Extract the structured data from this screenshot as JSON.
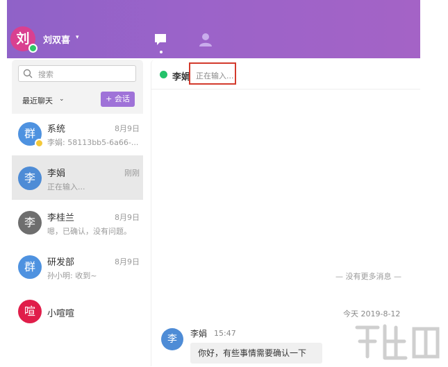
{
  "header": {
    "avatar_char": "刘",
    "user_name": "刘双喜",
    "caret": "▾",
    "nav": [
      "chat-bubble-icon",
      "contacts-person-icon"
    ]
  },
  "sidebar": {
    "search_placeholder": "搜索",
    "recent_label": "最近聊天",
    "recent_caret": "⌄",
    "new_chat_label": "+ 会话",
    "conversations": [
      {
        "avatar": "群",
        "color": "#4e92e0",
        "name": "系统",
        "time": "8月9日",
        "preview": "李娟: 58113bb5-6a66-...",
        "badge": true
      },
      {
        "avatar": "李",
        "color": "#4e8cd6",
        "name": "李娟",
        "time": "刚刚",
        "preview": "正在输入...",
        "active": true
      },
      {
        "avatar": "李",
        "color": "#6e6e6e",
        "name": "李桂兰",
        "time": "8月9日",
        "preview": "嗯，已确认，没有问题。"
      },
      {
        "avatar": "群",
        "color": "#4e92e0",
        "name": "研发部",
        "time": "8月9日",
        "preview": "孙小明: 收到~"
      },
      {
        "avatar": "喧",
        "color": "#e01e4a",
        "name": "小喧喧",
        "time": "",
        "preview": ""
      }
    ]
  },
  "chat": {
    "contact_name": "李娟",
    "typing_status": "正在输入...",
    "no_more_messages": "— 没有更多消息 —",
    "date_divider": "今天 2019-8-12",
    "message": {
      "avatar": "李",
      "sender": "李娟",
      "time": "15:47",
      "text": "你好，有些事情需要确认一下"
    }
  },
  "colors": {
    "header_gradient_start": "#8f62c8",
    "header_gradient_end": "#a463c6",
    "accent_button": "#9f72d8",
    "online_green": "#23c26a",
    "highlight_red": "#d33a2c"
  }
}
